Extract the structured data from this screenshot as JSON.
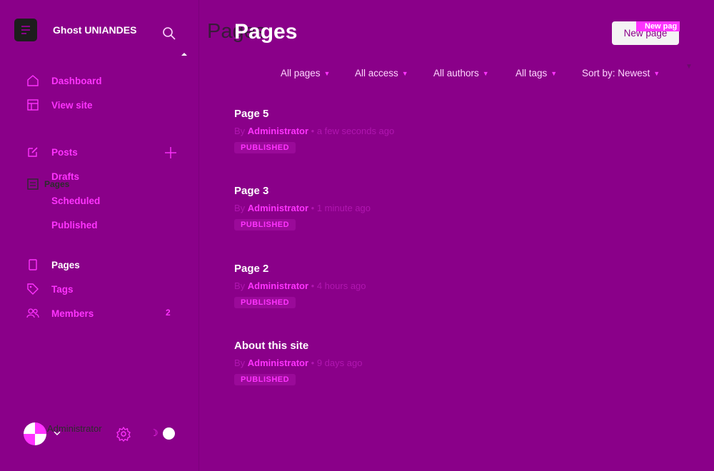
{
  "sidebar": {
    "brand": {
      "title": "Ghost UNIANDES",
      "ghost_title": "Ghost UNIANDES"
    },
    "nav": [
      {
        "label": "Dashboard"
      },
      {
        "label": "View site"
      },
      {
        "label": "Posts"
      },
      {
        "label": "Drafts"
      },
      {
        "label": "Scheduled"
      },
      {
        "label": "Published"
      },
      {
        "label": "Pages"
      },
      {
        "label": "Tags"
      },
      {
        "label": "Members",
        "count": "2"
      }
    ],
    "ghost_nav": [
      {
        "label": "Pages"
      }
    ],
    "footer": {
      "name": "Administrator"
    }
  },
  "main": {
    "title": "Pages",
    "ghost_title": "Pages",
    "new_button": "New page",
    "new_tag": "New pag",
    "filters": [
      {
        "label": "All pages"
      },
      {
        "label": "All access"
      },
      {
        "label": "All authors"
      },
      {
        "label": "All tags"
      },
      {
        "label": "Sort by: Newest"
      }
    ],
    "pages": [
      {
        "title": "Page 5",
        "by": "By",
        "author": "Administrator",
        "sep": "•",
        "time": "a few seconds ago",
        "status": "PUBLISHED"
      },
      {
        "title": "Page 3",
        "by": "By",
        "author": "Administrator",
        "sep": "•",
        "time": "1 minute ago",
        "status": "PUBLISHED"
      },
      {
        "title": "Page 2",
        "by": "By",
        "author": "Administrator",
        "sep": "•",
        "time": "4 hours ago",
        "status": "PUBLISHED"
      },
      {
        "title": "About this site",
        "by": "By",
        "author": "Administrator",
        "sep": "•",
        "time": "9 days ago",
        "status": "PUBLISHED"
      }
    ]
  },
  "colors": {
    "background": "#8a0089",
    "accent": "#ff33ff",
    "text": "#ffffff"
  },
  "icons": [
    "logo-icon",
    "search-icon",
    "home-icon",
    "view-site-icon",
    "posts-icon",
    "pages-ghost-icon",
    "pages-icon",
    "tag-icon",
    "members-icon",
    "plus-icon",
    "gear-icon",
    "moon-icon",
    "chevron-down-icon"
  ]
}
